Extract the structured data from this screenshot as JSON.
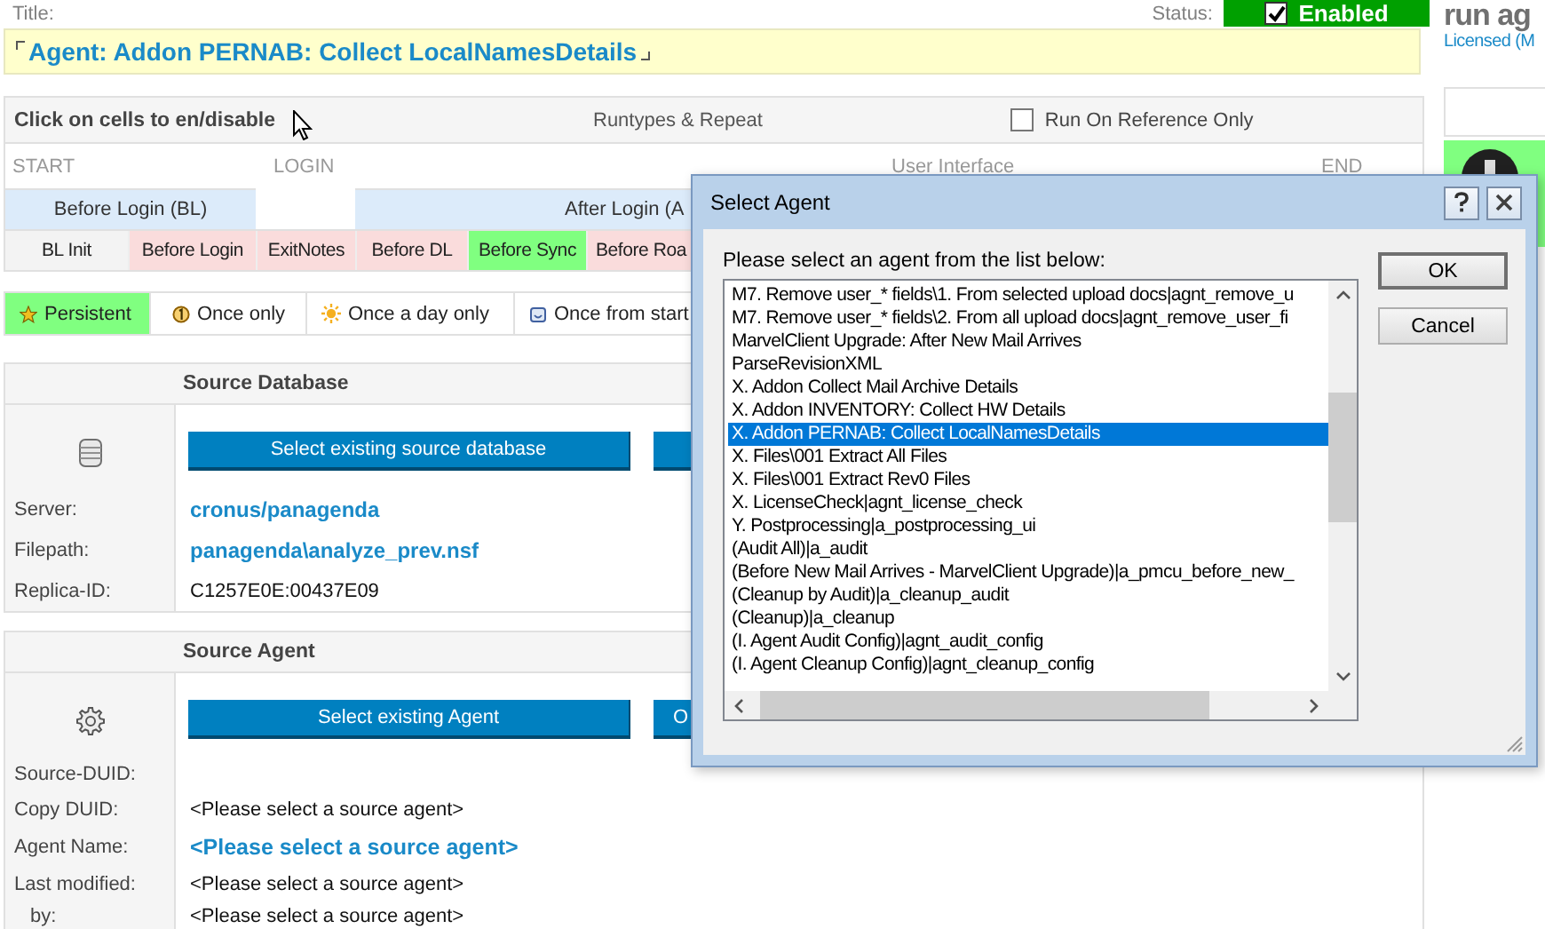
{
  "title_field": {
    "label": "Title:",
    "value": "Agent: Addon PERNAB: Collect LocalNamesDetails"
  },
  "status": {
    "label": "Status:",
    "enabled": true,
    "text": "Enabled"
  },
  "side": {
    "heading": "run ag",
    "link": "Licensed (M"
  },
  "runtypes": {
    "hint": "Click on cells to en/disable",
    "title": "Runtypes & Repeat",
    "reference_only": {
      "label": "Run On Reference Only",
      "checked": false
    },
    "phases": [
      "START",
      "LOGIN",
      "User Interface",
      "END"
    ],
    "groups": [
      {
        "label": "Before Login (BL)"
      },
      {
        "label": "After Login (A"
      }
    ],
    "cells": [
      {
        "label": "BL Init",
        "kind": "fixed"
      },
      {
        "label": "Before Login",
        "kind": "toggle",
        "enabled": false
      },
      {
        "label": "ExitNotes",
        "kind": "toggle",
        "enabled": false
      },
      {
        "label": "Before DL",
        "kind": "toggle",
        "enabled": false
      },
      {
        "label": "Before Sync",
        "kind": "toggle",
        "enabled": true
      },
      {
        "label": "Before Roa",
        "kind": "toggle",
        "enabled": false
      }
    ]
  },
  "repeat": [
    {
      "label": "Persistent",
      "selected": true
    },
    {
      "label": "Once only",
      "selected": false
    },
    {
      "label": "Once a day only",
      "selected": false
    },
    {
      "label": "Once from start",
      "selected": false
    }
  ],
  "source_database": {
    "heading": "Source Database",
    "button": "Select existing source database",
    "fields": [
      {
        "label": "Server:",
        "value": "cronus/panagenda",
        "kind": "link"
      },
      {
        "label": "Filepath:",
        "value": "panagenda\\analyze_prev.nsf",
        "kind": "link"
      },
      {
        "label": "Replica-ID:",
        "value": "C1257E0E:00437E09",
        "kind": "plain"
      }
    ]
  },
  "source_agent": {
    "heading": "Source Agent",
    "button": "Select existing Agent",
    "second_button": "O",
    "fields": [
      {
        "label": "Source-DUID:",
        "kind": "plain"
      },
      {
        "label": "Copy DUID:",
        "value": "<Please select a source agent>",
        "kind": "plain"
      },
      {
        "label": "Agent Name:",
        "value": "<Please select a source agent>",
        "kind": "big-link"
      },
      {
        "label": "Last modified:",
        "value": "<Please select a source agent>",
        "kind": "plain"
      },
      {
        "label": "by:",
        "value": "<Please select a source agent>",
        "kind": "sub"
      }
    ]
  },
  "dialog": {
    "title": "Select Agent",
    "prompt": "Please select an agent from the list below:",
    "buttons": [
      "OK",
      "Cancel"
    ],
    "items": [
      {
        "label": "M7. Remove user_* fields\\1. From selected upload docs|agnt_remove_u",
        "selected": false
      },
      {
        "label": "M7. Remove user_* fields\\2. From all upload docs|agnt_remove_user_fi",
        "selected": false
      },
      {
        "label": "MarvelClient Upgrade: After New Mail Arrives",
        "selected": false
      },
      {
        "label": "ParseRevisionXML",
        "selected": false
      },
      {
        "label": "X. Addon Collect Mail Archive Details",
        "selected": false
      },
      {
        "label": "X. Addon INVENTORY: Collect HW Details",
        "selected": false
      },
      {
        "label": "X. Addon PERNAB: Collect LocalNamesDetails",
        "selected": true
      },
      {
        "label": "X. Files\\001 Extract All Files",
        "selected": false
      },
      {
        "label": "X. Files\\001 Extract Rev0 Files",
        "selected": false
      },
      {
        "label": "X. LicenseCheck|agnt_license_check",
        "selected": false
      },
      {
        "label": "Y. Postprocessing|a_postprocessing_ui",
        "selected": false
      },
      {
        "label": "(Audit All)|a_audit",
        "selected": false
      },
      {
        "label": "(Before New Mail Arrives - MarvelClient Upgrade)|a_pmcu_before_new_",
        "selected": false
      },
      {
        "label": "(Cleanup by Audit)|a_cleanup_audit",
        "selected": false
      },
      {
        "label": "(Cleanup)|a_cleanup",
        "selected": false
      },
      {
        "label": "(I. Agent Audit Config)|agnt_audit_config",
        "selected": false
      },
      {
        "label": "(I. Agent Cleanup Config)|agnt_cleanup_config",
        "selected": false
      }
    ]
  }
}
